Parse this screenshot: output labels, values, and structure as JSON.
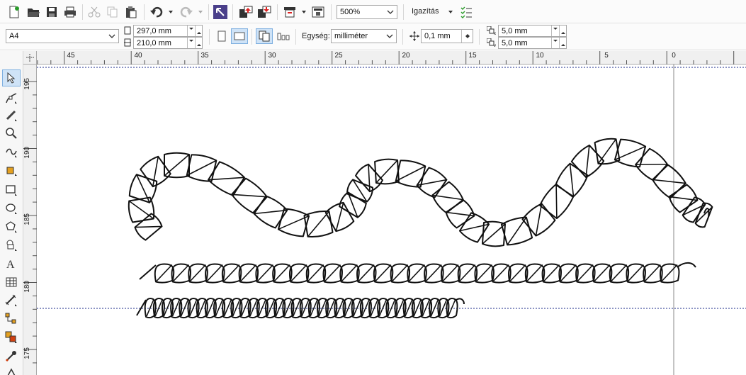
{
  "toolbar": {
    "zoom_value": "500%",
    "align_label": "Igazítás"
  },
  "property_bar": {
    "page_size": "A4",
    "width": "297,0 mm",
    "height": "210,0 mm",
    "unit_label": "Egység:",
    "unit_value": "milliméter",
    "nudge_value": "0,1 mm",
    "dup_x": "5,0 mm",
    "dup_y": "5,0 mm"
  },
  "ruler": {
    "h_labels": [
      "45",
      "40",
      "35",
      "30",
      "25",
      "20",
      "15",
      "10",
      "5",
      "0"
    ],
    "v_labels": [
      "195",
      "190",
      "185",
      "180",
      "175"
    ]
  },
  "colors": {
    "active_tool_bg": "#cfe3f7",
    "guide_line": "#1a2a8a"
  }
}
